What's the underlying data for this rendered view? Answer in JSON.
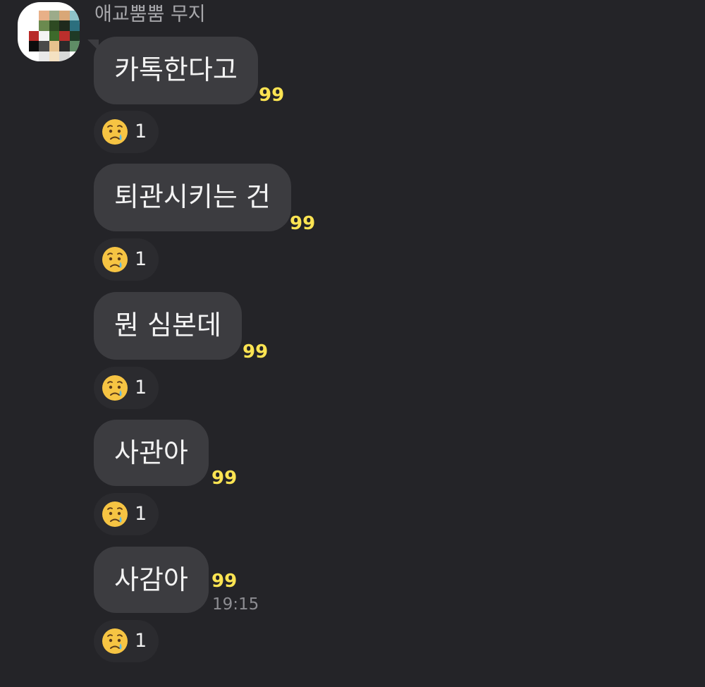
{
  "chat": {
    "sender_name": "애교뿜뿜 무지",
    "accent_color": "#fce452",
    "messages": [
      {
        "text": "카톡한다고",
        "unread_count": "99",
        "time": "",
        "reaction": {
          "emoji": "sad-crying-face-icon",
          "count": "1"
        }
      },
      {
        "text": "퇴관시키는 건",
        "unread_count": "99",
        "time": "",
        "reaction": {
          "emoji": "sad-crying-face-icon",
          "count": "1"
        }
      },
      {
        "text": "뭔 심본데",
        "unread_count": "99",
        "time": "",
        "reaction": {
          "emoji": "sad-crying-face-icon",
          "count": "1"
        }
      },
      {
        "text": "사관아",
        "unread_count": "99",
        "time": "",
        "reaction": {
          "emoji": "sad-crying-face-icon",
          "count": "1"
        }
      },
      {
        "text": "사감아",
        "unread_count": "99",
        "time": "19:15",
        "reaction": {
          "emoji": "sad-crying-face-icon",
          "count": "1"
        }
      }
    ]
  }
}
